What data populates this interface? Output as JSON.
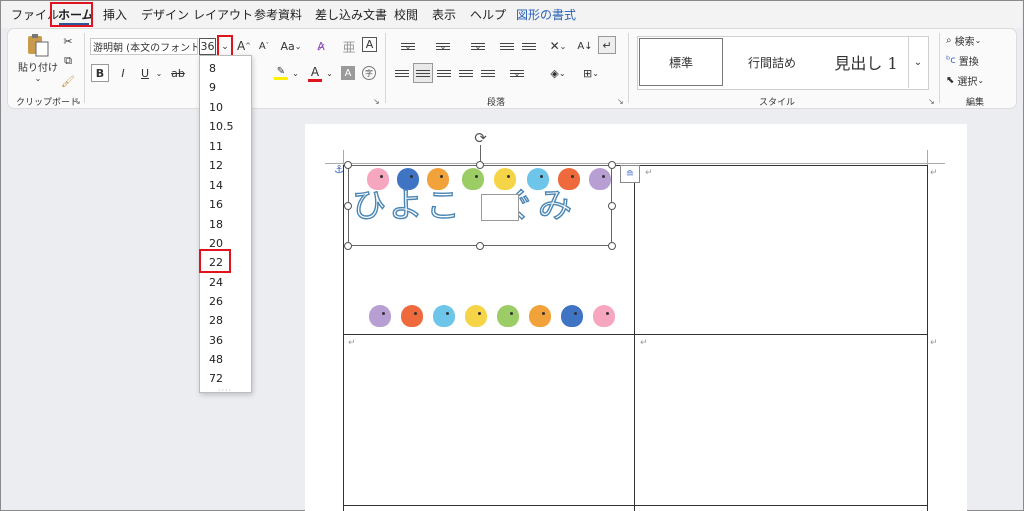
{
  "tabs": [
    {
      "label": "ファイル",
      "active": false
    },
    {
      "label": "ホーム",
      "active": true
    },
    {
      "label": "挿入",
      "active": false
    },
    {
      "label": "デザイン",
      "active": false
    },
    {
      "label": "レイアウト",
      "active": false
    },
    {
      "label": "参考資料",
      "active": false
    },
    {
      "label": "差し込み文書",
      "active": false
    },
    {
      "label": "校閲",
      "active": false
    },
    {
      "label": "表示",
      "active": false
    },
    {
      "label": "ヘルプ",
      "active": false
    },
    {
      "label": "図形の書式",
      "active": false,
      "contextual": true
    }
  ],
  "clipboard": {
    "paste_label": "貼り付け",
    "group_label": "クリップボード"
  },
  "font": {
    "family": "游明朝 (本文のフォント",
    "size": "36",
    "bold": "B",
    "italic": "I",
    "underline": "U",
    "strike": "ab",
    "grow": "A",
    "shrink": "A",
    "case": "Aa",
    "char_border": "A",
    "font_color": "A",
    "char_shading": "A",
    "enclose": "字"
  },
  "font_sizes": [
    "8",
    "9",
    "10",
    "10.5",
    "11",
    "12",
    "14",
    "16",
    "18",
    "20",
    "22",
    "24",
    "26",
    "28",
    "36",
    "48",
    "72"
  ],
  "highlighted_size": "22",
  "paragraph": {
    "group_label": "段落"
  },
  "styles": {
    "items": [
      "標準",
      "行間詰め",
      "見出し 1"
    ],
    "group_label": "スタイル"
  },
  "editing": {
    "find": "検索",
    "replace": "置換",
    "select": "選択",
    "group_label": "編集"
  },
  "document": {
    "title_text": "ひよこ　ぐみ"
  },
  "colors": {
    "accent": "#2b579a",
    "highlight_red": "#e0141e",
    "contextual_tab": "#2b62b8"
  }
}
